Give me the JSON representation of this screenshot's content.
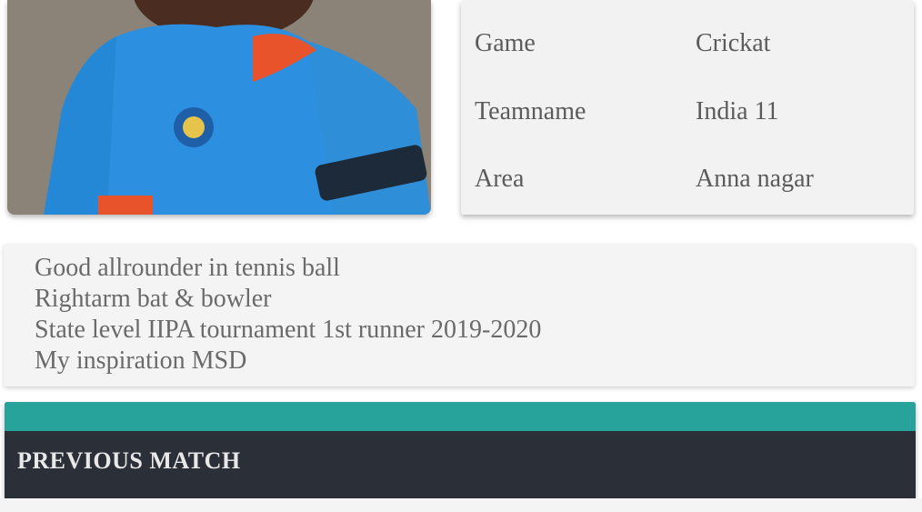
{
  "player_card": {
    "photo_alt": "Player photo"
  },
  "info": {
    "rows": [
      {
        "label": "Game",
        "value": "Crickat"
      },
      {
        "label": "Teamname",
        "value": "India 11"
      },
      {
        "label": "Area",
        "value": "Anna nagar"
      }
    ]
  },
  "about": {
    "lines": [
      "Good allrounder in tennis ball",
      "Rightarm bat & bowler",
      "State level IIPA tournament 1st runner 2019-2020",
      "My inspiration MSD"
    ]
  },
  "previous_match": {
    "title": "PREVIOUS MATCH"
  },
  "colors": {
    "accent": "#27a39b",
    "dark": "#2b3038",
    "jersey": "#2d8fe0"
  }
}
